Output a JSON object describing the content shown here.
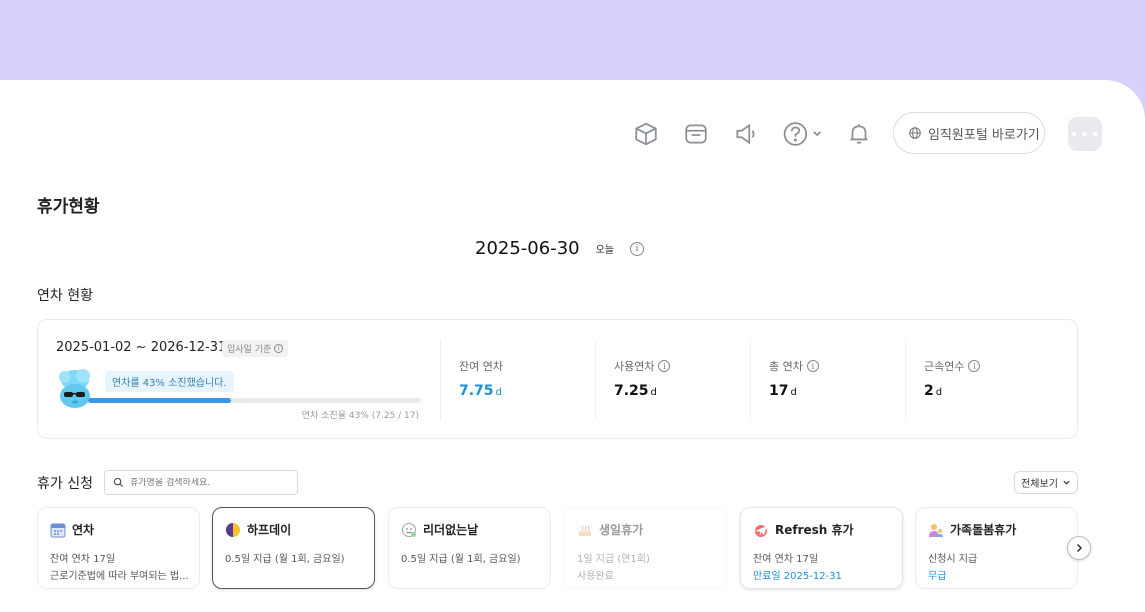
{
  "header": {
    "portal_label": "임직원포털 바로가기",
    "more_label": "•••"
  },
  "page": {
    "title": "휴가현황",
    "date": "2025-06-30",
    "today_label": "오늘"
  },
  "annual": {
    "section_title": "연차 현황",
    "period": "2025-01-02 ~ 2026-12-31",
    "basis_label": "입사일 기준",
    "consumed_message": "연차를 43% 소진했습니다.",
    "consumed_fraction": 0.43,
    "consumed_caption": "연차 소진율 43% (7.25 / 17)",
    "stats": [
      {
        "label": "잔여 연차",
        "value": "7.75",
        "unit": "d",
        "accent": true,
        "info": false
      },
      {
        "label": "사용연차",
        "value": "7.25",
        "unit": "d",
        "accent": false,
        "info": true
      },
      {
        "label": "총 연차",
        "value": "17",
        "unit": "d",
        "accent": false,
        "info": true
      },
      {
        "label": "근속연수",
        "value": "2",
        "unit": "d",
        "accent": false,
        "info": true
      }
    ]
  },
  "request": {
    "section_title": "휴가 신청",
    "search_placeholder": "휴가명을 검색하세요.",
    "view_all_label": "전체보기",
    "cards": [
      {
        "title": "연차",
        "icon": "calendar-icon",
        "line1": "잔여 연차 17일",
        "line2": "근로기준법에 따라 부여되는 법..."
      },
      {
        "title": "하프데이",
        "icon": "half-moon-icon",
        "line1": "0.5일 지급 (월 1회, 금요일)",
        "line2": ""
      },
      {
        "title": "리더없는날",
        "icon": "face-icon",
        "line1": "0.5일 지급 (월 1회, 금요일)",
        "line2": ""
      },
      {
        "title": "생일휴가",
        "icon": "cake-icon",
        "line1": "1일 지급 (연1회)",
        "line2": "사용완료"
      },
      {
        "title": "Refresh 휴가",
        "icon": "plane-icon",
        "line1": "잔여 연차 17일",
        "line2": "만료일 2025-12-31"
      },
      {
        "title": "가족돌봄휴가",
        "icon": "family-icon",
        "line1": "신청시 지급",
        "line2": "무급"
      }
    ]
  },
  "colors": {
    "top_band": "#d7d1fb",
    "accent_blue": "#1d8fd6",
    "progress": "#3c96e8"
  }
}
